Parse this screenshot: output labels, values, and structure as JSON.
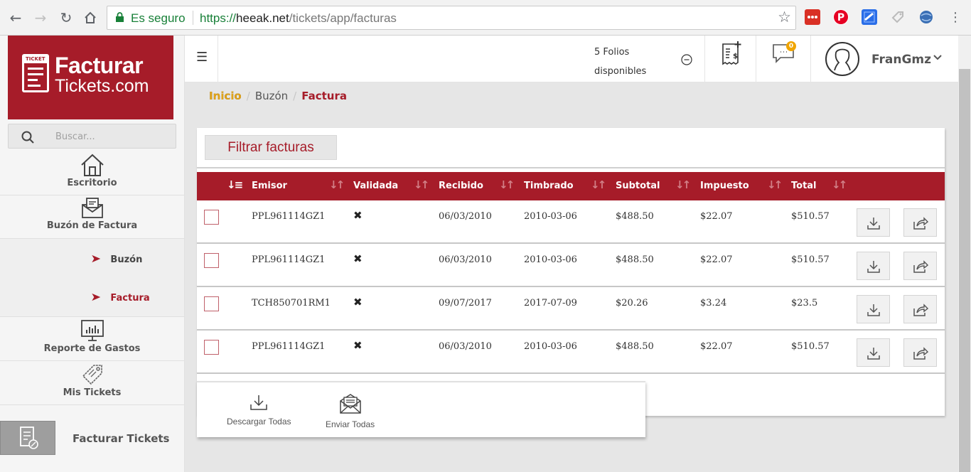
{
  "browser": {
    "secure_label": "Es seguro",
    "url_scheme": "https://",
    "url_host": "heeak.net",
    "url_path": "/tickets/app/facturas"
  },
  "logo": {
    "icon_text": "TICKET",
    "line1": "Facturar",
    "line2": "Tickets.com"
  },
  "search": {
    "placeholder": "Buscar..."
  },
  "sidebar": {
    "escritorio": "Escritorio",
    "buzon_factura": "Buzón de Factura",
    "sub_buzon": "Buzón",
    "sub_factura": "Factura",
    "reporte": "Reporte de Gastos",
    "mis_tickets": "Mis Tickets",
    "facturar": "Facturar Tickets"
  },
  "header": {
    "folios_line1": "5 Folios",
    "folios_line2": "disponibles",
    "badge_count": "0",
    "username": "FranGmz"
  },
  "breadcrumb": {
    "home": "Inicio",
    "buzon": "Buzón",
    "current": "Factura"
  },
  "filter_button": "Filtrar facturas",
  "table": {
    "headers": {
      "emisor": "Emisor",
      "validada": "Validada",
      "recibido": "Recibido",
      "timbrado": "Timbrado",
      "subtotal": "Subtotal",
      "impuesto": "Impuesto",
      "total": "Total"
    },
    "rows": [
      {
        "emisor": "PPL961114GZ1",
        "validada": "✖",
        "recibido": "06/03/2010",
        "timbrado": "2010-03-06",
        "subtotal": "$488.50",
        "impuesto": "$22.07",
        "total": "$510.57"
      },
      {
        "emisor": "PPL961114GZ1",
        "validada": "✖",
        "recibido": "06/03/2010",
        "timbrado": "2010-03-06",
        "subtotal": "$488.50",
        "impuesto": "$22.07",
        "total": "$510.57"
      },
      {
        "emisor": "TCH850701RM1",
        "validada": "✖",
        "recibido": "09/07/2017",
        "timbrado": "2017-07-09",
        "subtotal": "$20.26",
        "impuesto": "$3.24",
        "total": "$23.5"
      },
      {
        "emisor": "PPL961114GZ1",
        "validada": "✖",
        "recibido": "06/03/2010",
        "timbrado": "2010-03-06",
        "subtotal": "$488.50",
        "impuesto": "$22.07",
        "total": "$510.57"
      }
    ]
  },
  "bulk": {
    "download_all": "Descargar Todas",
    "send_all": "Enviar Todas"
  },
  "colors": {
    "brand": "#a61c29",
    "home_link": "#e0a31a",
    "secure": "#188038"
  }
}
